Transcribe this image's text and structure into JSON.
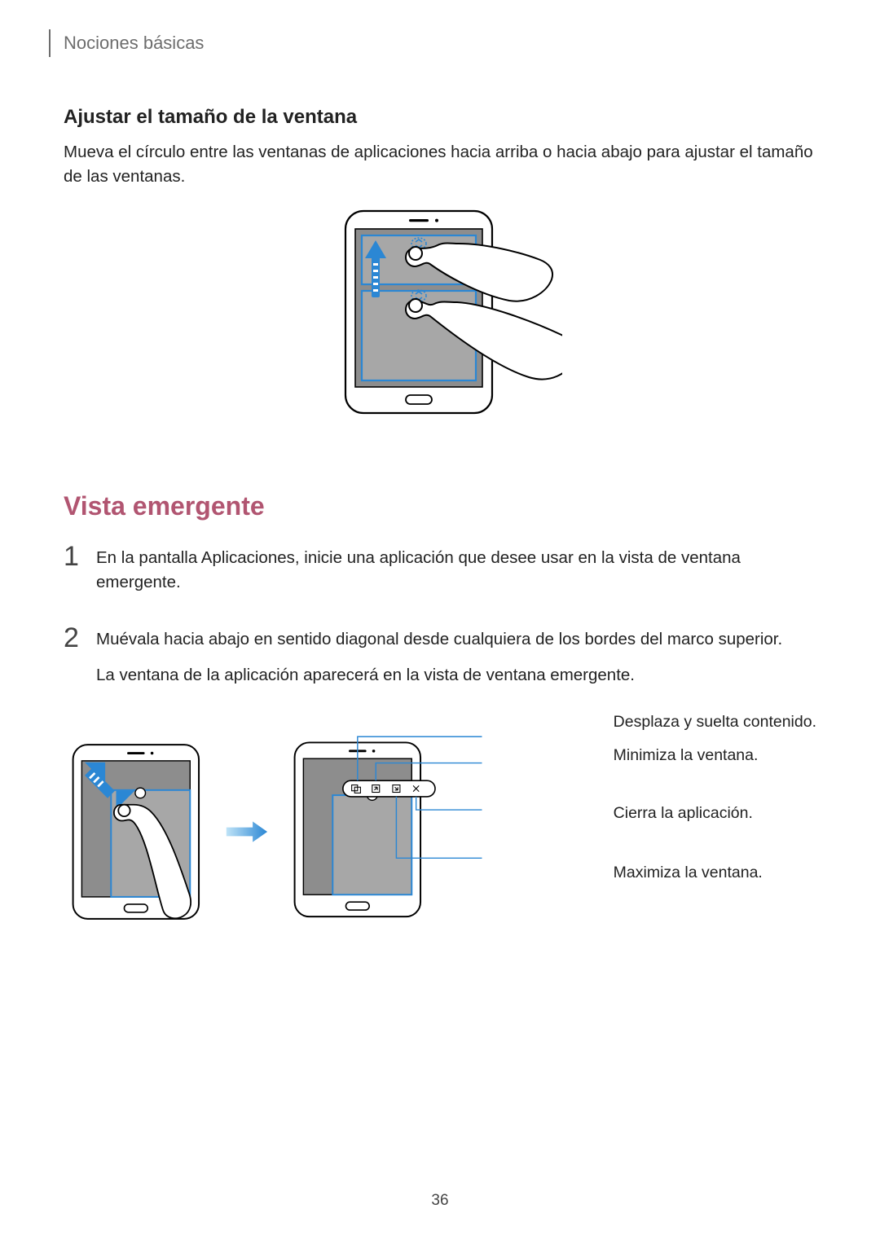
{
  "breadcrumb": "Nociones básicas",
  "section1": {
    "title": "Ajustar el tamaño de la ventana",
    "body": "Mueva el círculo entre las ventanas de aplicaciones hacia arriba o hacia abajo para ajustar el tamaño de las ventanas."
  },
  "section2": {
    "title": "Vista emergente",
    "steps": [
      {
        "num": "1",
        "text": "En la pantalla Aplicaciones, inicie una aplicación que desee usar en la vista de ventana emergente."
      },
      {
        "num": "2",
        "text1": "Muévala hacia abajo en sentido diagonal desde cualquiera de los bordes del marco superior.",
        "text2": "La ventana de la aplicación aparecerá en la vista de ventana emergente."
      }
    ]
  },
  "callouts": {
    "c1": "Desplaza y suelta contenido.",
    "c2": "Minimiza la ventana.",
    "c3": "Cierra la aplicación.",
    "c4": "Maximiza la ventana."
  },
  "page_number": "36"
}
